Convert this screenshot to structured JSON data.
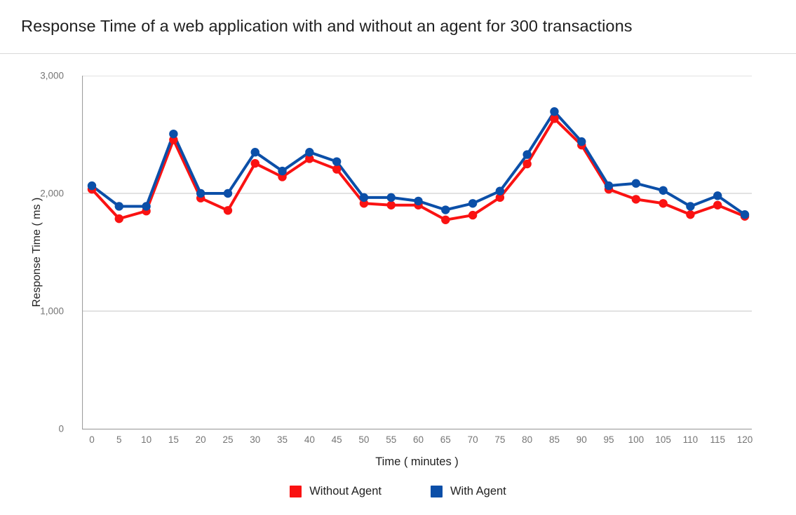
{
  "chart_data": {
    "type": "line",
    "title": "Response Time of a web application with and without an agent for 300 transactions",
    "xlabel": "Time ( minutes )",
    "ylabel": "Response Time ( ms )",
    "x": [
      0,
      5,
      10,
      15,
      20,
      25,
      30,
      35,
      40,
      45,
      50,
      55,
      60,
      65,
      70,
      75,
      80,
      85,
      90,
      95,
      100,
      105,
      110,
      115,
      120
    ],
    "xtick_labels": [
      "0",
      "5",
      "10",
      "15",
      "20",
      "25",
      "30",
      "35",
      "40",
      "45",
      "50",
      "55",
      "60",
      "65",
      "70",
      "75",
      "80",
      "85",
      "90",
      "95",
      "100",
      "105",
      "110",
      "115",
      "120"
    ],
    "ytick_labels": [
      "0",
      "1,000",
      "2,000",
      "3,000"
    ],
    "ytick_values": [
      0,
      1000,
      2000,
      3000
    ],
    "xlim": [
      0,
      120
    ],
    "ylim": [
      0,
      3000
    ],
    "grid": "horizontal",
    "legend_position": "bottom",
    "series": [
      {
        "name": "Without Agent",
        "color": "#FA1212",
        "values": [
          2035,
          1785,
          1850,
          2455,
          1960,
          1855,
          2255,
          2140,
          2295,
          2205,
          1915,
          1900,
          1900,
          1775,
          1815,
          1965,
          2250,
          2635,
          2410,
          2035,
          1950,
          1915,
          1820,
          1900,
          1805
        ]
      },
      {
        "name": "With Agent",
        "color": "#0B4FA8",
        "values": [
          2065,
          1890,
          1890,
          2505,
          2000,
          2000,
          2350,
          2190,
          2350,
          2270,
          1965,
          1965,
          1935,
          1860,
          1915,
          2020,
          2330,
          2695,
          2440,
          2065,
          2085,
          2025,
          1890,
          1980,
          1820
        ]
      }
    ]
  },
  "colors": {
    "gridline": "#d9d9d9",
    "axis": "#9e9e9e",
    "tick_text": "#757575",
    "title_text": "#212121",
    "background": "#ffffff"
  }
}
